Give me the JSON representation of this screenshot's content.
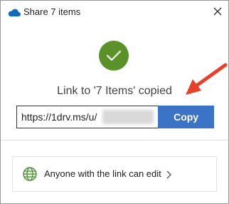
{
  "window": {
    "title": "Share 7 items",
    "brand_color": "#0f6cbd"
  },
  "icons": {
    "app": "onedrive-cloud-icon",
    "close": "close-icon",
    "success": "checkmark-icon",
    "permission": "globe-icon",
    "expand": "chevron-right-icon"
  },
  "status": {
    "message": "Link to '7 Items' copied",
    "success_color": "#5a9229"
  },
  "link": {
    "value": "https://1drv.ms/u/",
    "copy_label": "Copy",
    "button_color": "#3b73c7"
  },
  "permission": {
    "label": "Anyone with the link can edit"
  },
  "annotation": {
    "arrow_color": "#e8402a"
  }
}
